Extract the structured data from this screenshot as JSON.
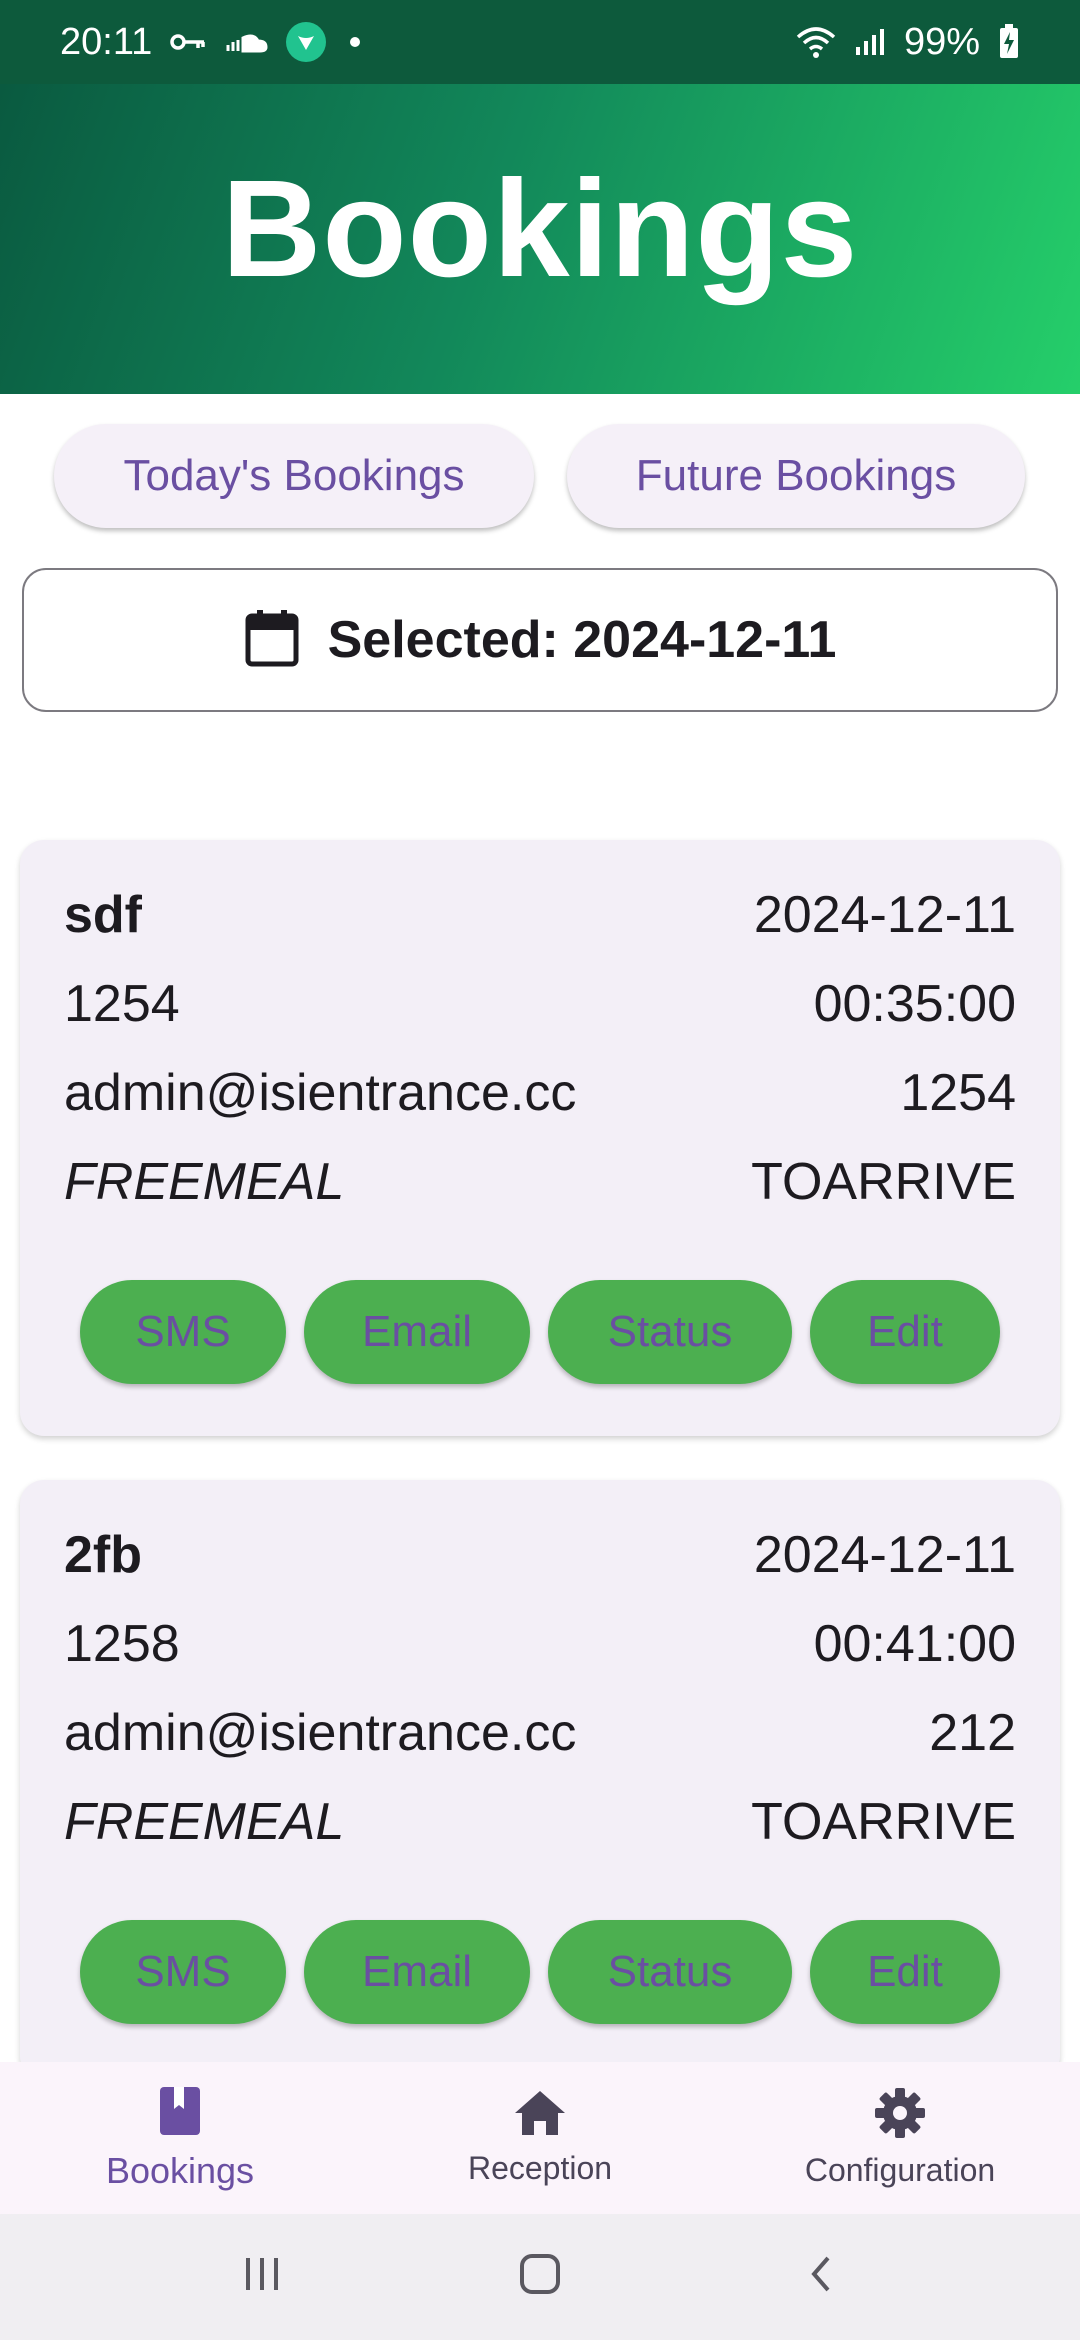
{
  "status_bar": {
    "time": "20:11",
    "battery": "99%",
    "icons": [
      "key-icon",
      "cloud-icon",
      "app-notification-icon",
      "dot-icon",
      "wifi-icon",
      "signal-icon",
      "battery-charging-icon"
    ]
  },
  "header": {
    "title": "Bookings"
  },
  "filters": {
    "today_label": "Today's Bookings",
    "future_label": "Future Bookings"
  },
  "date_selector": {
    "icon": "calendar-icon",
    "text": "Selected: 2024-12-11"
  },
  "bookings": [
    {
      "name": "sdf",
      "date": "2024-12-11",
      "id": "1254",
      "time": "00:35:00",
      "email": "admin@isientrance.cc",
      "number": "1254",
      "type": "FREEMEAL",
      "status": "TOARRIVE",
      "actions": {
        "sms": "SMS",
        "email": "Email",
        "status": "Status",
        "edit": "Edit"
      }
    },
    {
      "name": "2fb",
      "date": "2024-12-11",
      "id": "1258",
      "time": "00:41:00",
      "email": "admin@isientrance.cc",
      "number": "212",
      "type": "FREEMEAL",
      "status": "TOARRIVE",
      "actions": {
        "sms": "SMS",
        "email": "Email",
        "status": "Status",
        "edit": "Edit"
      }
    }
  ],
  "bottom_nav": {
    "items": [
      {
        "label": "Bookings",
        "icon": "book-icon",
        "active": true
      },
      {
        "label": "Reception",
        "icon": "home-icon",
        "active": false
      },
      {
        "label": "Configuration",
        "icon": "gear-icon",
        "active": false
      }
    ]
  },
  "colors": {
    "accent": "#6a4fa2",
    "action_green": "#4caf50",
    "header_gradient_start": "#0a5a40",
    "header_gradient_end": "#25cf6a"
  }
}
